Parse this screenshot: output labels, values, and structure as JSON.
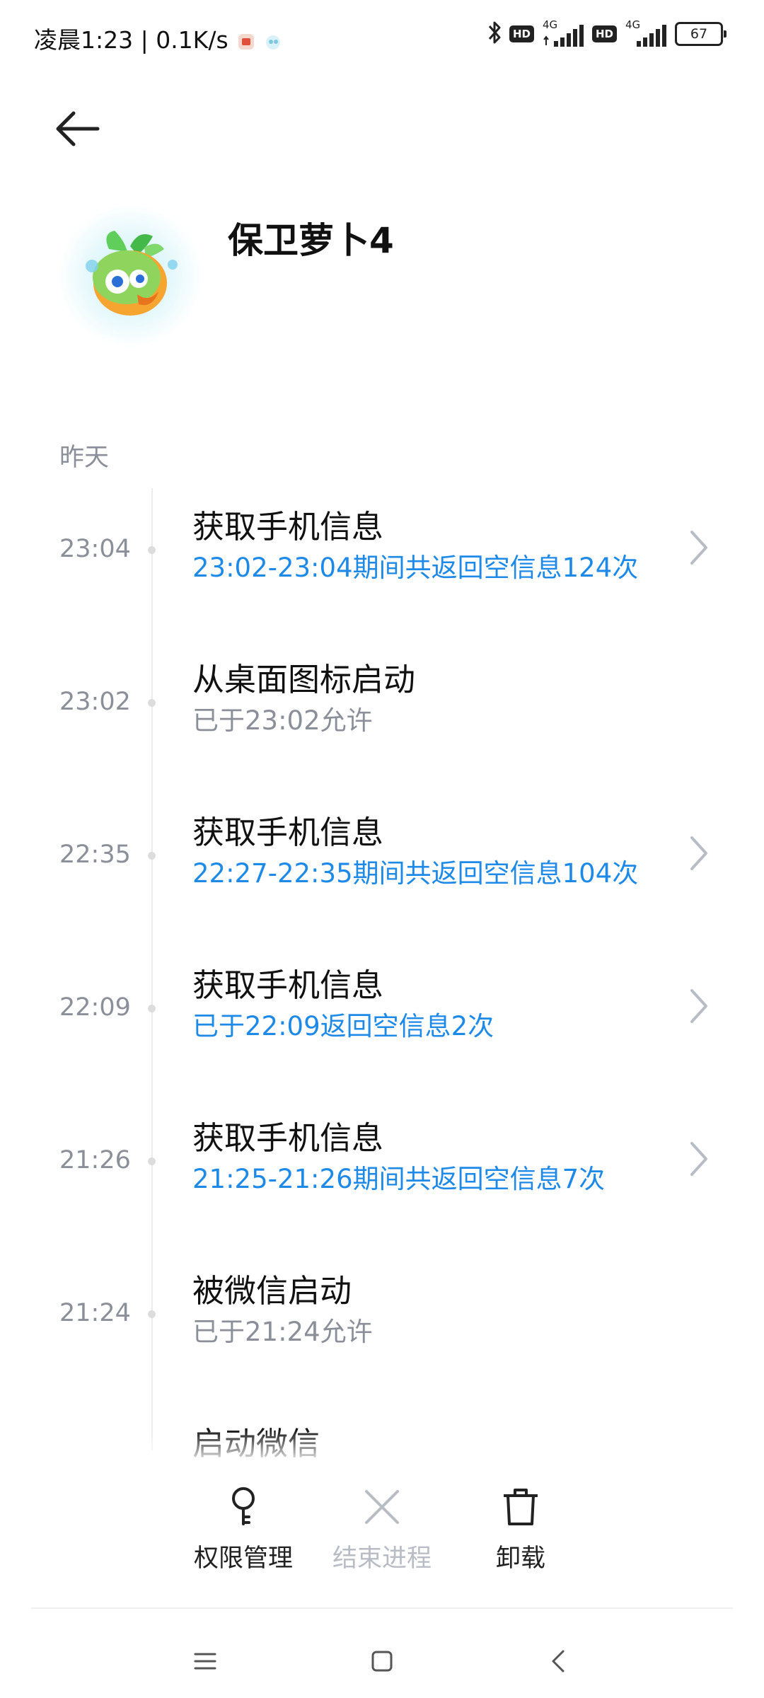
{
  "status_bar": {
    "time_speed": "凌晨1:23 | 0.1K/s",
    "hd_label": "HD",
    "network_label": "4G",
    "battery_level": "67"
  },
  "header": {
    "app_name": "保卫萝卜4"
  },
  "timeline": {
    "section_label": "昨天",
    "entries": [
      {
        "time": "23:04",
        "title": "获取手机信息",
        "subtitle": "23:02-23:04期间共返回空信息124次",
        "subtitle_color": "#1e8ae8",
        "has_chevron": true
      },
      {
        "time": "23:02",
        "title": "从桌面图标启动",
        "subtitle": "已于23:02允许",
        "subtitle_color": "#8a8f99",
        "has_chevron": false
      },
      {
        "time": "22:35",
        "title": "获取手机信息",
        "subtitle": "22:27-22:35期间共返回空信息104次",
        "subtitle_color": "#1e8ae8",
        "has_chevron": true
      },
      {
        "time": "22:09",
        "title": "获取手机信息",
        "subtitle": "已于22:09返回空信息2次",
        "subtitle_color": "#1e8ae8",
        "has_chevron": true
      },
      {
        "time": "21:26",
        "title": "获取手机信息",
        "subtitle": "21:25-21:26期间共返回空信息7次",
        "subtitle_color": "#1e8ae8",
        "has_chevron": true
      },
      {
        "time": "21:24",
        "title": "被微信启动",
        "subtitle": "已于21:24允许",
        "subtitle_color": "#8a8f99",
        "has_chevron": false
      },
      {
        "time": "",
        "title": "启动微信",
        "subtitle": "",
        "subtitle_color": "#8a8f99",
        "has_chevron": false
      }
    ]
  },
  "actions": {
    "permissions_label": "权限管理",
    "end_process_label": "结束进程",
    "uninstall_label": "卸载"
  },
  "icons": {
    "back": "arrow-left-icon",
    "chevron": "chevron-right-icon",
    "permissions": "key-icon",
    "end_process": "close-x-icon",
    "uninstall": "trash-icon",
    "nav_menu": "menu-icon",
    "nav_home": "square-icon",
    "nav_back": "chevron-left-icon"
  },
  "colors": {
    "accent_blue": "#1e8ae8",
    "secondary_gray": "#8a8f99",
    "disabled_gray": "#b8bcc4"
  }
}
